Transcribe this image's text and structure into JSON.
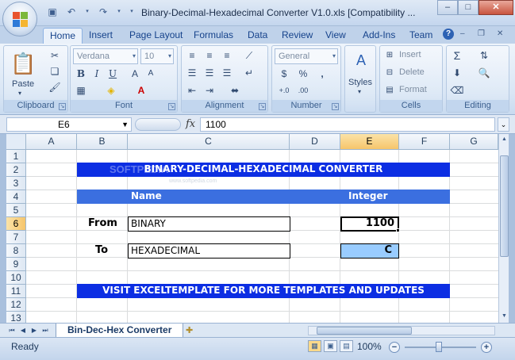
{
  "window": {
    "title": "Binary-Decimal-Hexadecimal Converter V1.0.xls  [Compatibility ...",
    "min": "–",
    "max": "□",
    "close": "✕"
  },
  "tabs": [
    "Home",
    "Insert",
    "Page Layout",
    "Formulas",
    "Data",
    "Review",
    "View",
    "Add-Ins",
    "Team"
  ],
  "ribbon": {
    "font_name": "Verdana",
    "font_size": "10",
    "number_format": "General",
    "paste_label": "Paste",
    "styles_label": "Styles",
    "insert_label": "Insert",
    "delete_label": "Delete",
    "format_label": "Format",
    "groups": {
      "clipboard": "Clipboard",
      "font": "Font",
      "alignment": "Alignment",
      "number": "Number",
      "cells": "Cells",
      "editing": "Editing"
    }
  },
  "formula_bar": {
    "name_box": "E6",
    "fx": "fx",
    "value": "1100"
  },
  "columns": [
    "A",
    "B",
    "C",
    "D",
    "E",
    "F",
    "G"
  ],
  "rows": [
    "1",
    "2",
    "3",
    "4",
    "5",
    "6",
    "7",
    "8",
    "9",
    "10",
    "11",
    "12",
    "13"
  ],
  "sheet": {
    "title": "BINARY-DECIMAL-HEXADECIMAL CONVERTER",
    "header_name": "Name",
    "header_integer": "Integer",
    "from_label": "From",
    "from_value": "BINARY",
    "from_integer": "1100",
    "to_label": "To",
    "to_value": "HEXADECIMAL",
    "to_integer": "C",
    "footer": "VISIT EXCELTEMPLATE FOR MORE TEMPLATES AND UPDATES",
    "watermark": "SOFTPEDIA",
    "watermark_url": "www.softpedia.com"
  },
  "sheet_tab": "Bin-Dec-Hex Converter",
  "status": {
    "ready": "Ready",
    "zoom": "100%"
  }
}
